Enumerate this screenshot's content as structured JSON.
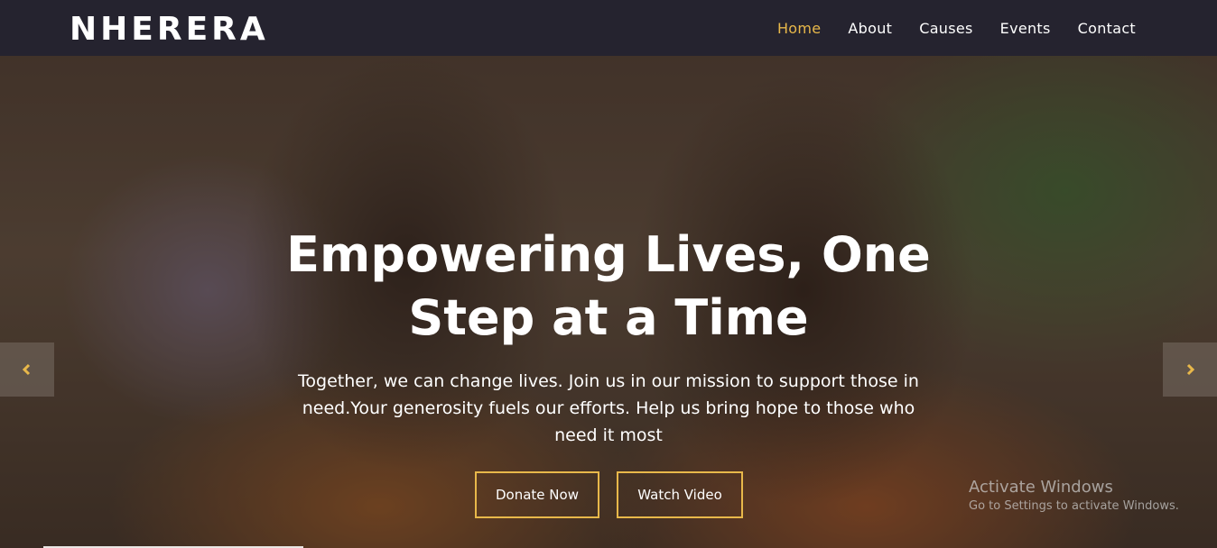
{
  "brand": {
    "logo_text": "NHERERA"
  },
  "nav": {
    "items": [
      {
        "label": "Home",
        "active": true
      },
      {
        "label": "About",
        "active": false
      },
      {
        "label": "Causes",
        "active": false
      },
      {
        "label": "Events",
        "active": false
      },
      {
        "label": "Contact",
        "active": false
      }
    ]
  },
  "hero": {
    "title": "Empowering Lives, One Step at a Time",
    "text": "Together, we can change lives. Join us in our mission to support those in need.Your generosity fuels our efforts. Help us bring hope to those who need it most",
    "buttons": {
      "donate": "Donate Now",
      "video": "Watch Video"
    },
    "prev_icon": "chevron-left-icon",
    "next_icon": "chevron-right-icon"
  },
  "watermark": {
    "title": "Activate Windows",
    "subtitle": "Go to Settings to activate Windows."
  },
  "colors": {
    "navbar_bg": "#25232f",
    "accent": "#e8b84a",
    "text": "#ffffff"
  }
}
